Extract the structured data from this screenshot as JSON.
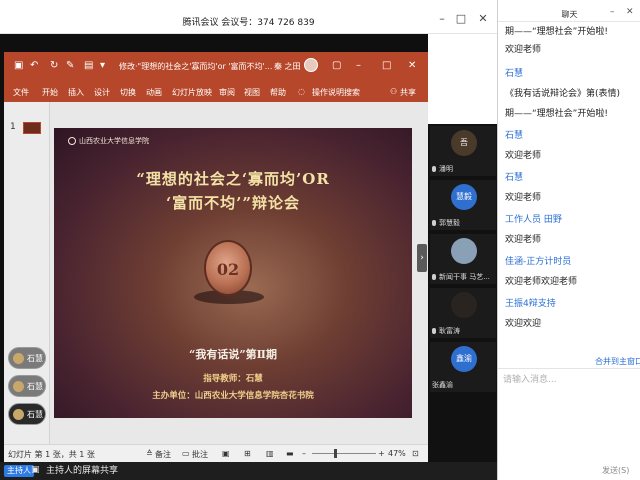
{
  "meeting": {
    "title": "腾讯会议 会议号：374 726 839",
    "minimize": "–",
    "maximize": "□",
    "close": "✕"
  },
  "ppt": {
    "doc_title": "修改·\"理想的社会之'寡而均'or '富而不均'...",
    "user": "秦 之田",
    "window_controls": {
      "ribbon": "▢",
      "minimize": "–",
      "maximize": "□",
      "close": "✕"
    },
    "menu": [
      "文件",
      "开始",
      "插入",
      "设计",
      "切换",
      "动画",
      "幻灯片放映",
      "审阅",
      "视图",
      "帮助"
    ],
    "search": "操作说明搜索",
    "share": "共享",
    "slide_number": "1",
    "status": {
      "slide_info": "幻灯片 第 1 张，共 1 张",
      "notes": "备注",
      "comments": "批注",
      "zoom_minus": "–",
      "zoom_plus": "+",
      "zoom": "47%"
    }
  },
  "slide": {
    "logo_text": "山西农业大学信息学院",
    "title_line1": "“理想的社会之‘寡而均’OR",
    "title_line2": "‘富而不均’”辩论会",
    "coin_text": "02",
    "subtitle": "“我有话说”第Ⅱ期",
    "advisor": "指导教师：石慧",
    "organizer": "主办单位：山西农业大学信息学院杏花书院"
  },
  "chips": [
    "石慧",
    "石慧",
    "石慧"
  ],
  "participants": [
    {
      "name": "潘明",
      "avatar": "吾",
      "color": "#4a3a2a"
    },
    {
      "name": "郭慧毅",
      "avatar": "慧毅",
      "color": "#2f6fd0"
    },
    {
      "name": "新闻干事 马艺...",
      "avatar": "",
      "color": "#8aa0b6"
    },
    {
      "name": "耿富涛",
      "avatar": "",
      "color": "#2a2420"
    },
    {
      "name": "张鑫渝",
      "avatar": "鑫渝",
      "color": "#2f6fd0"
    }
  ],
  "bottom": {
    "host_label": "主持人",
    "share_text": "主持人的屏幕共享"
  },
  "chat": {
    "title": "聊天",
    "messages": [
      {
        "type": "msg",
        "text": "期——“理想社会”开始啦!"
      },
      {
        "type": "msg",
        "text": "欢迎老师"
      },
      {
        "type": "sender",
        "text": "石慧"
      },
      {
        "type": "msg",
        "text": "《我有话说辩论会》第(表情)"
      },
      {
        "type": "msg",
        "text": "期——“理想社会”开始啦!"
      },
      {
        "type": "sender",
        "text": "石慧"
      },
      {
        "type": "msg",
        "text": "欢迎老师"
      },
      {
        "type": "sender",
        "text": "石慧"
      },
      {
        "type": "msg",
        "text": "欢迎老师"
      },
      {
        "type": "sender",
        "text": "工作人员  田野"
      },
      {
        "type": "msg",
        "text": "欢迎老师"
      },
      {
        "type": "sender",
        "text": "佳涵-正方计时员"
      },
      {
        "type": "msg",
        "text": "欢迎老师欢迎老师"
      },
      {
        "type": "sender",
        "text": "王振4辩支持"
      },
      {
        "type": "msg",
        "text": "欢迎欢迎"
      }
    ],
    "link": "合并到主窗口",
    "input_placeholder": "请输入消息...",
    "send": "发送(S)"
  }
}
